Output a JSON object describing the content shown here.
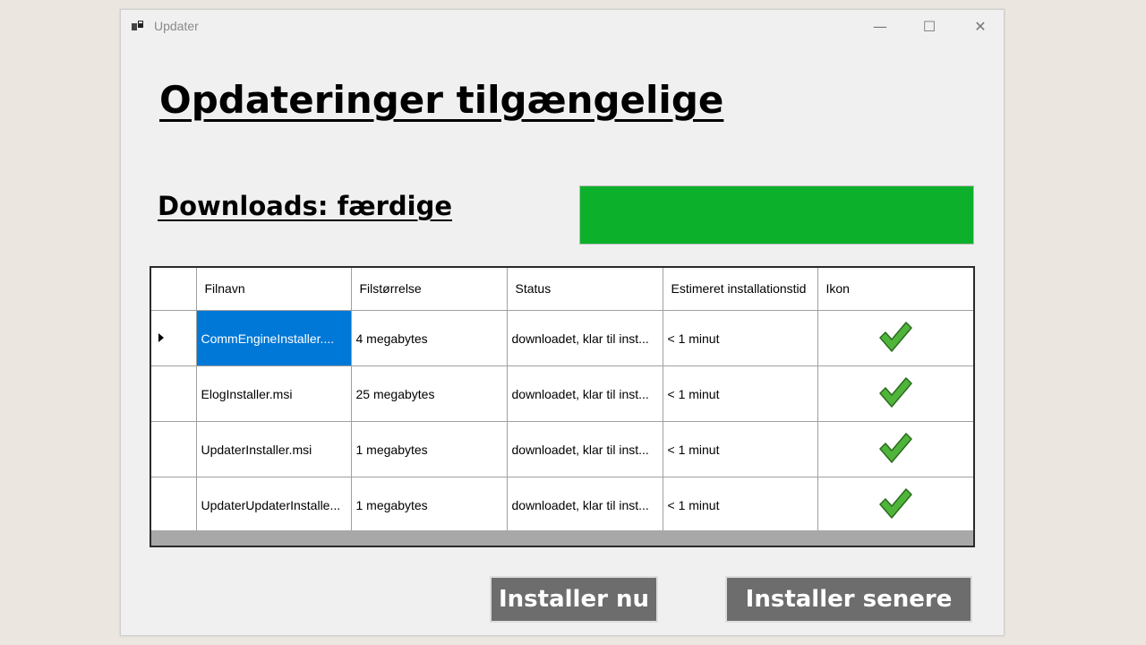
{
  "window": {
    "title": "Updater",
    "controls": {
      "minimize": "—",
      "maximize": "☐",
      "close": "✕"
    }
  },
  "main": {
    "heading": "Opdateringer tilgængelige",
    "downloads_status": "Downloads: færdige",
    "progress": {
      "fraction": 1.0,
      "color": "#0db02b"
    }
  },
  "grid": {
    "columns": [
      "",
      "Filnavn",
      "Filstørrelse",
      "Status",
      "Estimeret installationstid",
      "Ikon"
    ],
    "rows": [
      {
        "filename": "CommEngineInstaller....",
        "size": "4 megabytes",
        "status": "downloadet, klar til inst...",
        "time": "< 1 minut",
        "icon": "checkmark-icon",
        "current": true
      },
      {
        "filename": "ElogInstaller.msi",
        "size": "25 megabytes",
        "status": "downloadet, klar til inst...",
        "time": "< 1 minut",
        "icon": "checkmark-icon",
        "current": false
      },
      {
        "filename": "UpdaterInstaller.msi",
        "size": "1 megabytes",
        "status": "downloadet, klar til inst...",
        "time": "< 1 minut",
        "icon": "checkmark-icon",
        "current": false
      },
      {
        "filename": "UpdaterUpdaterInstalle...",
        "size": "1 megabytes",
        "status": "downloadet, klar til inst...",
        "time": "< 1 minut",
        "icon": "checkmark-icon",
        "current": false
      }
    ],
    "selection_color": "#0078d7",
    "check_color": "#4fb53a"
  },
  "buttons": {
    "install_now": "Installer nu",
    "install_later": "Installer senere"
  }
}
